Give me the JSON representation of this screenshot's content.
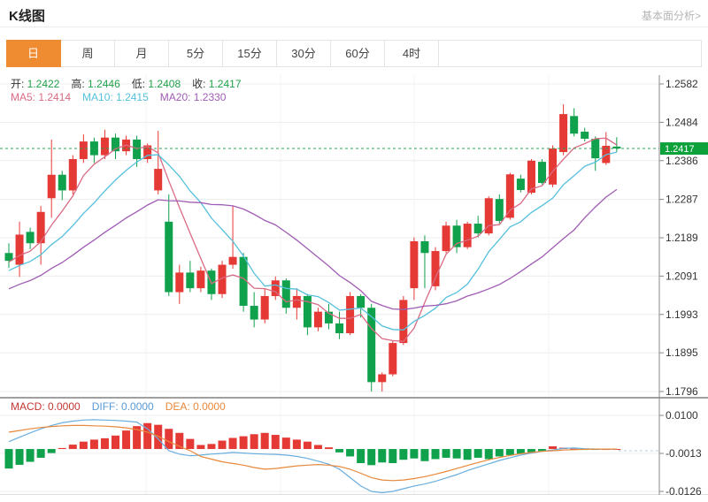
{
  "header": {
    "title": "K线图",
    "link": "基本面分析>"
  },
  "tabs": {
    "items": [
      "日",
      "周",
      "月",
      "5分",
      "15分",
      "30分",
      "60分",
      "4时"
    ],
    "active_index": 0
  },
  "readouts": {
    "ohlc": [
      {
        "label": "开:",
        "value": "1.2422"
      },
      {
        "label": "高:",
        "value": "1.2446"
      },
      {
        "label": "低:",
        "value": "1.2408"
      },
      {
        "label": "收:",
        "value": "1.2417"
      }
    ],
    "ohlc_value_color": "#1fa24a",
    "ma": [
      {
        "label": "MA5:",
        "value": "1.2414",
        "color": "#d96b84"
      },
      {
        "label": "MA10:",
        "value": "1.2415",
        "color": "#55c0dc"
      },
      {
        "label": "MA20:",
        "value": "1.2330",
        "color": "#a05cb4"
      }
    ],
    "macd": [
      {
        "label": "MACD:",
        "value": "0.0000",
        "color": "#c23632"
      },
      {
        "label": "DIFF:",
        "value": "0.0000",
        "color": "#5b9bd5"
      },
      {
        "label": "DEA:",
        "value": "0.0000",
        "color": "#e8883a"
      }
    ]
  },
  "colors": {
    "up": "#e53935",
    "down": "#0fa14b",
    "accent": "#ef8b31",
    "price_tag_bg": "#0ca13a",
    "dashed_price_line": "#2ba157",
    "grid": "#ececec",
    "axis": "#888888",
    "separator": "#a0a0a0"
  },
  "chart_data": [
    {
      "type": "candlestick",
      "title": "K线图 (daily K-line, OHLC candles, red=up green=down)",
      "y_ticks": [
        1.2582,
        1.2484,
        1.2386,
        1.2287,
        1.2189,
        1.2091,
        1.1993,
        1.1895,
        1.1796
      ],
      "ylim": [
        1.1796,
        1.2582
      ],
      "current_price": 1.2417,
      "ma_series": [
        {
          "name": "MA5",
          "period": 5,
          "value": 1.2414,
          "color": "#d96b84"
        },
        {
          "name": "MA10",
          "period": 10,
          "value": 1.2415,
          "color": "#55c0dc"
        },
        {
          "name": "MA20",
          "period": 20,
          "value": 1.233,
          "color": "#a05cb4"
        }
      ],
      "last_candle": {
        "open": 1.2422,
        "high": 1.2446,
        "low": 1.2408,
        "close": 1.2417
      },
      "candles_ohlc": [
        [
          1.215,
          1.2175,
          1.2112,
          1.213
        ],
        [
          1.212,
          1.223,
          1.2089,
          1.2197
        ],
        [
          1.2204,
          1.2215,
          1.216,
          1.2175
        ],
        [
          1.2175,
          1.227,
          1.212,
          1.2255
        ],
        [
          1.229,
          1.244,
          1.224,
          1.235
        ],
        [
          1.235,
          1.236,
          1.2285,
          1.231
        ],
        [
          1.231,
          1.24,
          1.23,
          1.239
        ],
        [
          1.239,
          1.2453,
          1.238,
          1.2435
        ],
        [
          1.2435,
          1.2445,
          1.238,
          1.24
        ],
        [
          1.24,
          1.2465,
          1.239,
          1.2445
        ],
        [
          1.2445,
          1.2455,
          1.239,
          1.241
        ],
        [
          1.241,
          1.245,
          1.24,
          1.244
        ],
        [
          1.244,
          1.245,
          1.237,
          1.239
        ],
        [
          1.239,
          1.243,
          1.238,
          1.2425
        ],
        [
          1.231,
          1.2462,
          1.23,
          1.2365
        ],
        [
          1.223,
          1.23,
          1.204,
          1.205
        ],
        [
          1.205,
          1.212,
          1.202,
          1.21
        ],
        [
          1.21,
          1.213,
          1.205,
          1.206
        ],
        [
          1.206,
          1.2115,
          1.205,
          1.2105
        ],
        [
          1.2105,
          1.211,
          1.203,
          1.2045
        ],
        [
          1.2045,
          1.213,
          1.2035,
          1.212
        ],
        [
          1.212,
          1.227,
          1.211,
          1.214
        ],
        [
          1.214,
          1.215,
          1.2,
          1.2015
        ],
        [
          1.2015,
          1.205,
          1.196,
          1.198
        ],
        [
          1.198,
          1.206,
          1.197,
          1.204
        ],
        [
          1.204,
          1.209,
          1.203,
          1.208
        ],
        [
          1.208,
          1.2085,
          1.1995,
          1.201
        ],
        [
          1.201,
          1.206,
          1.198,
          1.204
        ],
        [
          1.204,
          1.2045,
          1.194,
          1.196
        ],
        [
          1.196,
          1.201,
          1.195,
          1.2
        ],
        [
          1.2,
          1.202,
          1.1955,
          1.197
        ],
        [
          1.197,
          1.2,
          1.193,
          1.1945
        ],
        [
          1.1945,
          1.205,
          1.194,
          1.204
        ],
        [
          1.204,
          1.2045,
          1.1985,
          1.201
        ],
        [
          1.201,
          1.202,
          1.1796,
          1.182
        ],
        [
          1.182,
          1.1845,
          1.1796,
          1.184
        ],
        [
          1.184,
          1.1925,
          1.1835,
          1.192
        ],
        [
          1.192,
          1.204,
          1.1915,
          1.203
        ],
        [
          1.206,
          1.219,
          1.203,
          1.218
        ],
        [
          1.218,
          1.2195,
          1.206,
          1.215
        ],
        [
          1.2065,
          1.2165,
          1.2055,
          1.2155
        ],
        [
          1.2155,
          1.223,
          1.215,
          1.222
        ],
        [
          1.222,
          1.2235,
          1.215,
          1.2165
        ],
        [
          1.2165,
          1.223,
          1.216,
          1.2225
        ],
        [
          1.2225,
          1.2245,
          1.219,
          1.22
        ],
        [
          1.22,
          1.2295,
          1.2195,
          1.229
        ],
        [
          1.2288,
          1.23,
          1.2225,
          1.2232
        ],
        [
          1.224,
          1.2355,
          1.2235,
          1.2351
        ],
        [
          1.234,
          1.235,
          1.2305,
          1.2311
        ],
        [
          1.2304,
          1.239,
          1.23,
          1.2386
        ],
        [
          1.2383,
          1.239,
          1.2325,
          1.2329
        ],
        [
          1.2325,
          1.2425,
          1.2318,
          1.2417
        ],
        [
          1.2408,
          1.253,
          1.24,
          1.2505
        ],
        [
          1.25,
          1.252,
          1.2448,
          1.2455
        ],
        [
          1.246,
          1.247,
          1.2435,
          1.2442
        ],
        [
          1.2442,
          1.2448,
          1.236,
          1.2392
        ],
        [
          1.238,
          1.2459,
          1.2375,
          1.2424
        ],
        [
          1.2422,
          1.2446,
          1.2408,
          1.2417
        ]
      ]
    },
    {
      "type": "bar",
      "title": "MACD (histogram with DIFF / DEA lines)",
      "y_ticks": [
        0.01,
        -0.0013,
        -0.0126
      ],
      "ylim": [
        -0.0126,
        0.01
      ],
      "current": {
        "macd": 0.0,
        "diff": 0.0,
        "dea": 0.0
      },
      "bars": [
        -0.0058,
        -0.0047,
        -0.0038,
        -0.0026,
        -0.0012,
        0.0003,
        0.0013,
        0.0022,
        0.0028,
        0.0032,
        0.004,
        0.0055,
        0.0068,
        0.0077,
        0.0072,
        0.006,
        0.0048,
        0.003,
        0.0012,
        0.0015,
        0.0025,
        0.0033,
        0.0038,
        0.0044,
        0.0048,
        0.0042,
        0.0034,
        0.0028,
        0.0022,
        0.0012,
        0.0005,
        -0.001,
        -0.0022,
        -0.0042,
        -0.0048,
        -0.004,
        -0.0042,
        -0.0032,
        -0.0028,
        -0.0036,
        -0.003,
        -0.0026,
        -0.0028,
        -0.0032,
        -0.0026,
        -0.003,
        -0.0022,
        -0.0018,
        -0.0014,
        -0.001,
        -0.0006,
        0.0008,
        0.0004,
        0.0001,
        -0.0002,
        -0.0001,
        0.0,
        0.0
      ],
      "diff": [
        0.0022,
        0.0035,
        0.0048,
        0.006,
        0.007,
        0.0078,
        0.0083,
        0.0086,
        0.0087,
        0.0086,
        0.0085,
        0.0083,
        0.008,
        0.006,
        0.003,
        -0.0005,
        -0.0015,
        -0.002,
        -0.0018,
        -0.0015,
        -0.0013,
        -0.001,
        -0.0012,
        -0.0014,
        -0.0015,
        -0.0016,
        -0.0018,
        -0.0022,
        -0.0028,
        -0.0036,
        -0.0045,
        -0.006,
        -0.0085,
        -0.011,
        -0.0126,
        -0.013,
        -0.0126,
        -0.0118,
        -0.011,
        -0.0104,
        -0.0096,
        -0.0086,
        -0.0076,
        -0.0064,
        -0.0054,
        -0.0044,
        -0.0034,
        -0.0026,
        -0.0018,
        -0.0012,
        -0.0007,
        -0.0003,
        0.0002,
        0.0003,
        0.0001,
        0.0,
        0.0,
        0.0
      ],
      "dea": [
        0.005,
        0.0055,
        0.006,
        0.0064,
        0.0067,
        0.0069,
        0.007,
        0.007,
        0.0069,
        0.0068,
        0.0066,
        0.0063,
        0.0058,
        0.005,
        0.0038,
        0.0022,
        0.0008,
        -0.0005,
        -0.0022,
        -0.003,
        -0.0038,
        -0.0043,
        -0.0048,
        -0.0055,
        -0.006,
        -0.0058,
        -0.0054,
        -0.005,
        -0.0048,
        -0.0046,
        -0.0048,
        -0.0052,
        -0.006,
        -0.0072,
        -0.0085,
        -0.0092,
        -0.0094,
        -0.0092,
        -0.0088,
        -0.0082,
        -0.0075,
        -0.0067,
        -0.0058,
        -0.0049,
        -0.004,
        -0.0032,
        -0.0025,
        -0.0019,
        -0.0014,
        -0.001,
        -0.0007,
        -0.0005,
        -0.0003,
        -0.0002,
        -0.0001,
        0.0,
        0.0,
        0.0
      ],
      "diff_color": "#6aaede",
      "dea_color": "#e8883a"
    }
  ]
}
